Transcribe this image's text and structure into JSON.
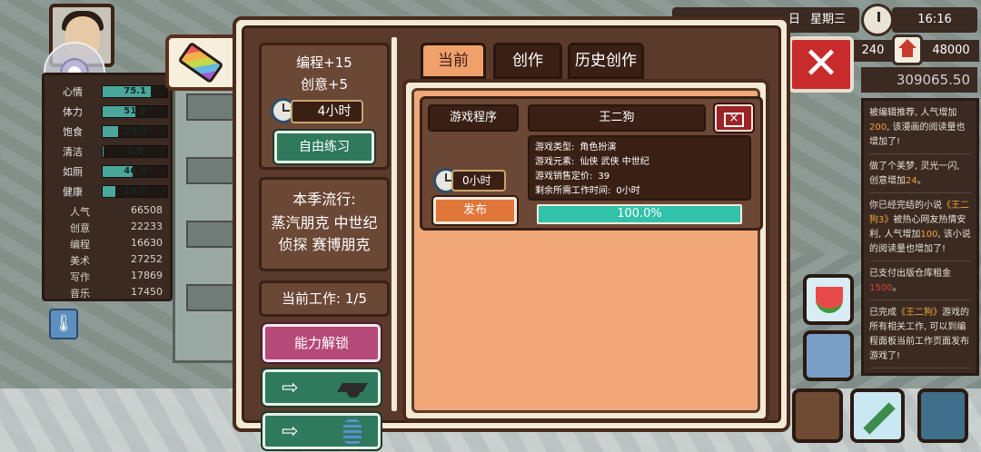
{
  "hud": {
    "date_prefix": "日",
    "weekday": "星期三",
    "time": "16:16",
    "value1": "240",
    "value2": "48000",
    "money": "309065.50"
  },
  "stats": {
    "bars": [
      {
        "label": "心情",
        "value": "75.1",
        "fraction": 0.75
      },
      {
        "label": "体力",
        "value": "51.3",
        "fraction": 0.51
      },
      {
        "label": "饱食",
        "value": "23.0",
        "fraction": 0.23
      },
      {
        "label": "清洁",
        "value": "1.0",
        "fraction": 0.01
      },
      {
        "label": "如厕",
        "value": "46.8",
        "fraction": 0.47
      },
      {
        "label": "健康",
        "value": "19.7",
        "fraction": 0.2
      }
    ],
    "attributes": [
      {
        "label": "人气",
        "value": "66508"
      },
      {
        "label": "创意",
        "value": "22233"
      },
      {
        "label": "编程",
        "value": "16630"
      },
      {
        "label": "美术",
        "value": "27252"
      },
      {
        "label": "写作",
        "value": "17869"
      },
      {
        "label": "音乐",
        "value": "17450"
      }
    ]
  },
  "side": {
    "skill_line1": "编程+15",
    "skill_line2": "创意+5",
    "hours": "4小时",
    "practice_button": "自由练习",
    "trend_title": "本季流行:",
    "trend_line1": "蒸汽朋克 中世纪",
    "trend_line2": "侦探 赛博朋克",
    "current_work": "当前工作:  1/5",
    "unlock_button": "能力解锁"
  },
  "tabs": {
    "current": "当前",
    "create": "创作",
    "history": "历史创作"
  },
  "work_card": {
    "type_label": "游戏程序",
    "title": "王二狗",
    "delete_symbol": "×",
    "info": [
      {
        "k": "游戏类型:",
        "v": "角色扮演"
      },
      {
        "k": "游戏元素:",
        "v": "仙侠  武侠  中世纪"
      },
      {
        "k": "游戏销售定价:",
        "v": "39"
      },
      {
        "k": "剩余所需工作时间:",
        "v": "0小时"
      }
    ],
    "hours": "0小时",
    "publish_button": "发布",
    "progress_text": "100.0%",
    "progress_fraction": 1.0
  },
  "log": {
    "entries": [
      {
        "parts": [
          {
            "t": "被编辑推荐, 人气增加"
          },
          {
            "t": "200",
            "c": "hl"
          },
          {
            "t": ", 该漫画的阅读量也增加了!"
          }
        ]
      },
      {
        "parts": [
          {
            "t": "做了个美梦, 灵光一闪, 创意增加"
          },
          {
            "t": "24",
            "c": "hl"
          },
          {
            "t": "。"
          }
        ]
      },
      {
        "parts": [
          {
            "t": "你已经完结的小说"
          },
          {
            "t": "《王二狗3》",
            "c": "hl"
          },
          {
            "t": "被热心网友热情安利, 人气增加"
          },
          {
            "t": "100",
            "c": "hl"
          },
          {
            "t": ", 该小说的阅读量也增加了!"
          }
        ]
      },
      {
        "parts": [
          {
            "t": "已支付出版仓库租金"
          },
          {
            "t": "1500",
            "c": "red"
          },
          {
            "t": "。"
          }
        ]
      },
      {
        "parts": [
          {
            "t": "已完成"
          },
          {
            "t": "《王二狗》",
            "c": "hl"
          },
          {
            "t": "游戏的所有相关工作, 可以到编程面板当前工作页面发布游戏了!"
          }
        ]
      }
    ]
  }
}
